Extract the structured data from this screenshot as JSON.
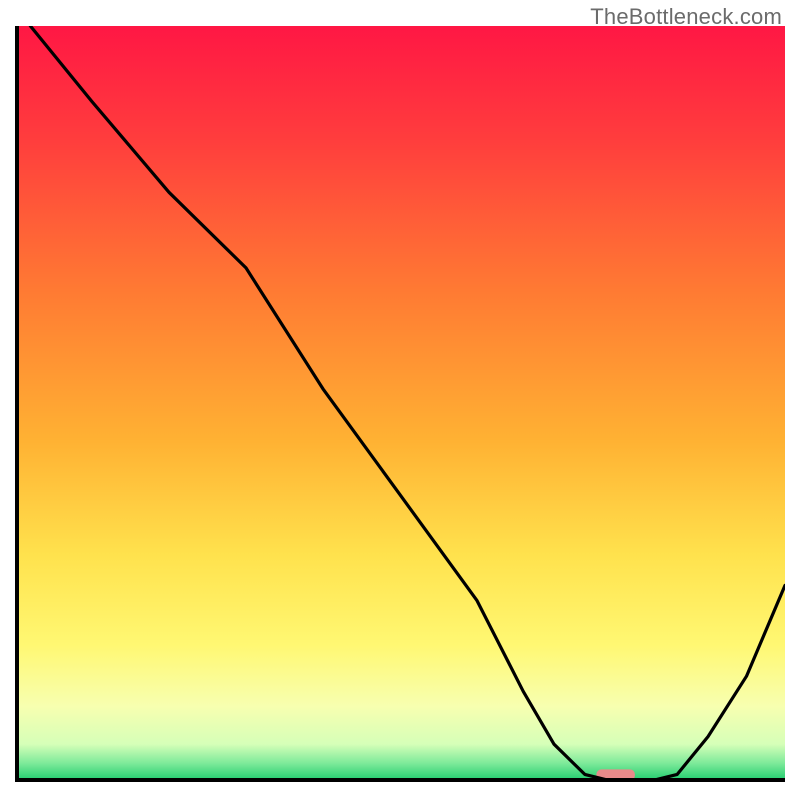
{
  "watermark": "TheBottleneck.com",
  "chart_data": {
    "type": "line",
    "title": "",
    "xlabel": "",
    "ylabel": "",
    "xlim": [
      0,
      100
    ],
    "ylim": [
      0,
      100
    ],
    "x": [
      2,
      10,
      20,
      30,
      40,
      50,
      60,
      66,
      70,
      74,
      78,
      82,
      86,
      90,
      95,
      100
    ],
    "y": [
      100,
      90,
      78,
      68,
      52,
      38,
      24,
      12,
      5,
      1,
      0,
      0,
      1,
      6,
      14,
      26
    ],
    "note": "Values are approximate pixel-to-percent readings of the black curve. The curve descends steeply from upper-left, bends slightly near x≈20, reaches a flat minimum around x≈75–82, then rises toward the right edge.",
    "marker": {
      "x": 78,
      "y": 1,
      "width_pct": 5,
      "color": "#e88a8a"
    }
  },
  "gradient_stops": [
    {
      "offset": 0.0,
      "color": "#ff1744"
    },
    {
      "offset": 0.15,
      "color": "#ff3d3d"
    },
    {
      "offset": 0.35,
      "color": "#ff7a33"
    },
    {
      "offset": 0.55,
      "color": "#ffb233"
    },
    {
      "offset": 0.7,
      "color": "#ffe24d"
    },
    {
      "offset": 0.82,
      "color": "#fff873"
    },
    {
      "offset": 0.9,
      "color": "#f7ffb0"
    },
    {
      "offset": 0.95,
      "color": "#d6ffb8"
    },
    {
      "offset": 0.975,
      "color": "#7eea9a"
    },
    {
      "offset": 1.0,
      "color": "#18c96a"
    }
  ]
}
